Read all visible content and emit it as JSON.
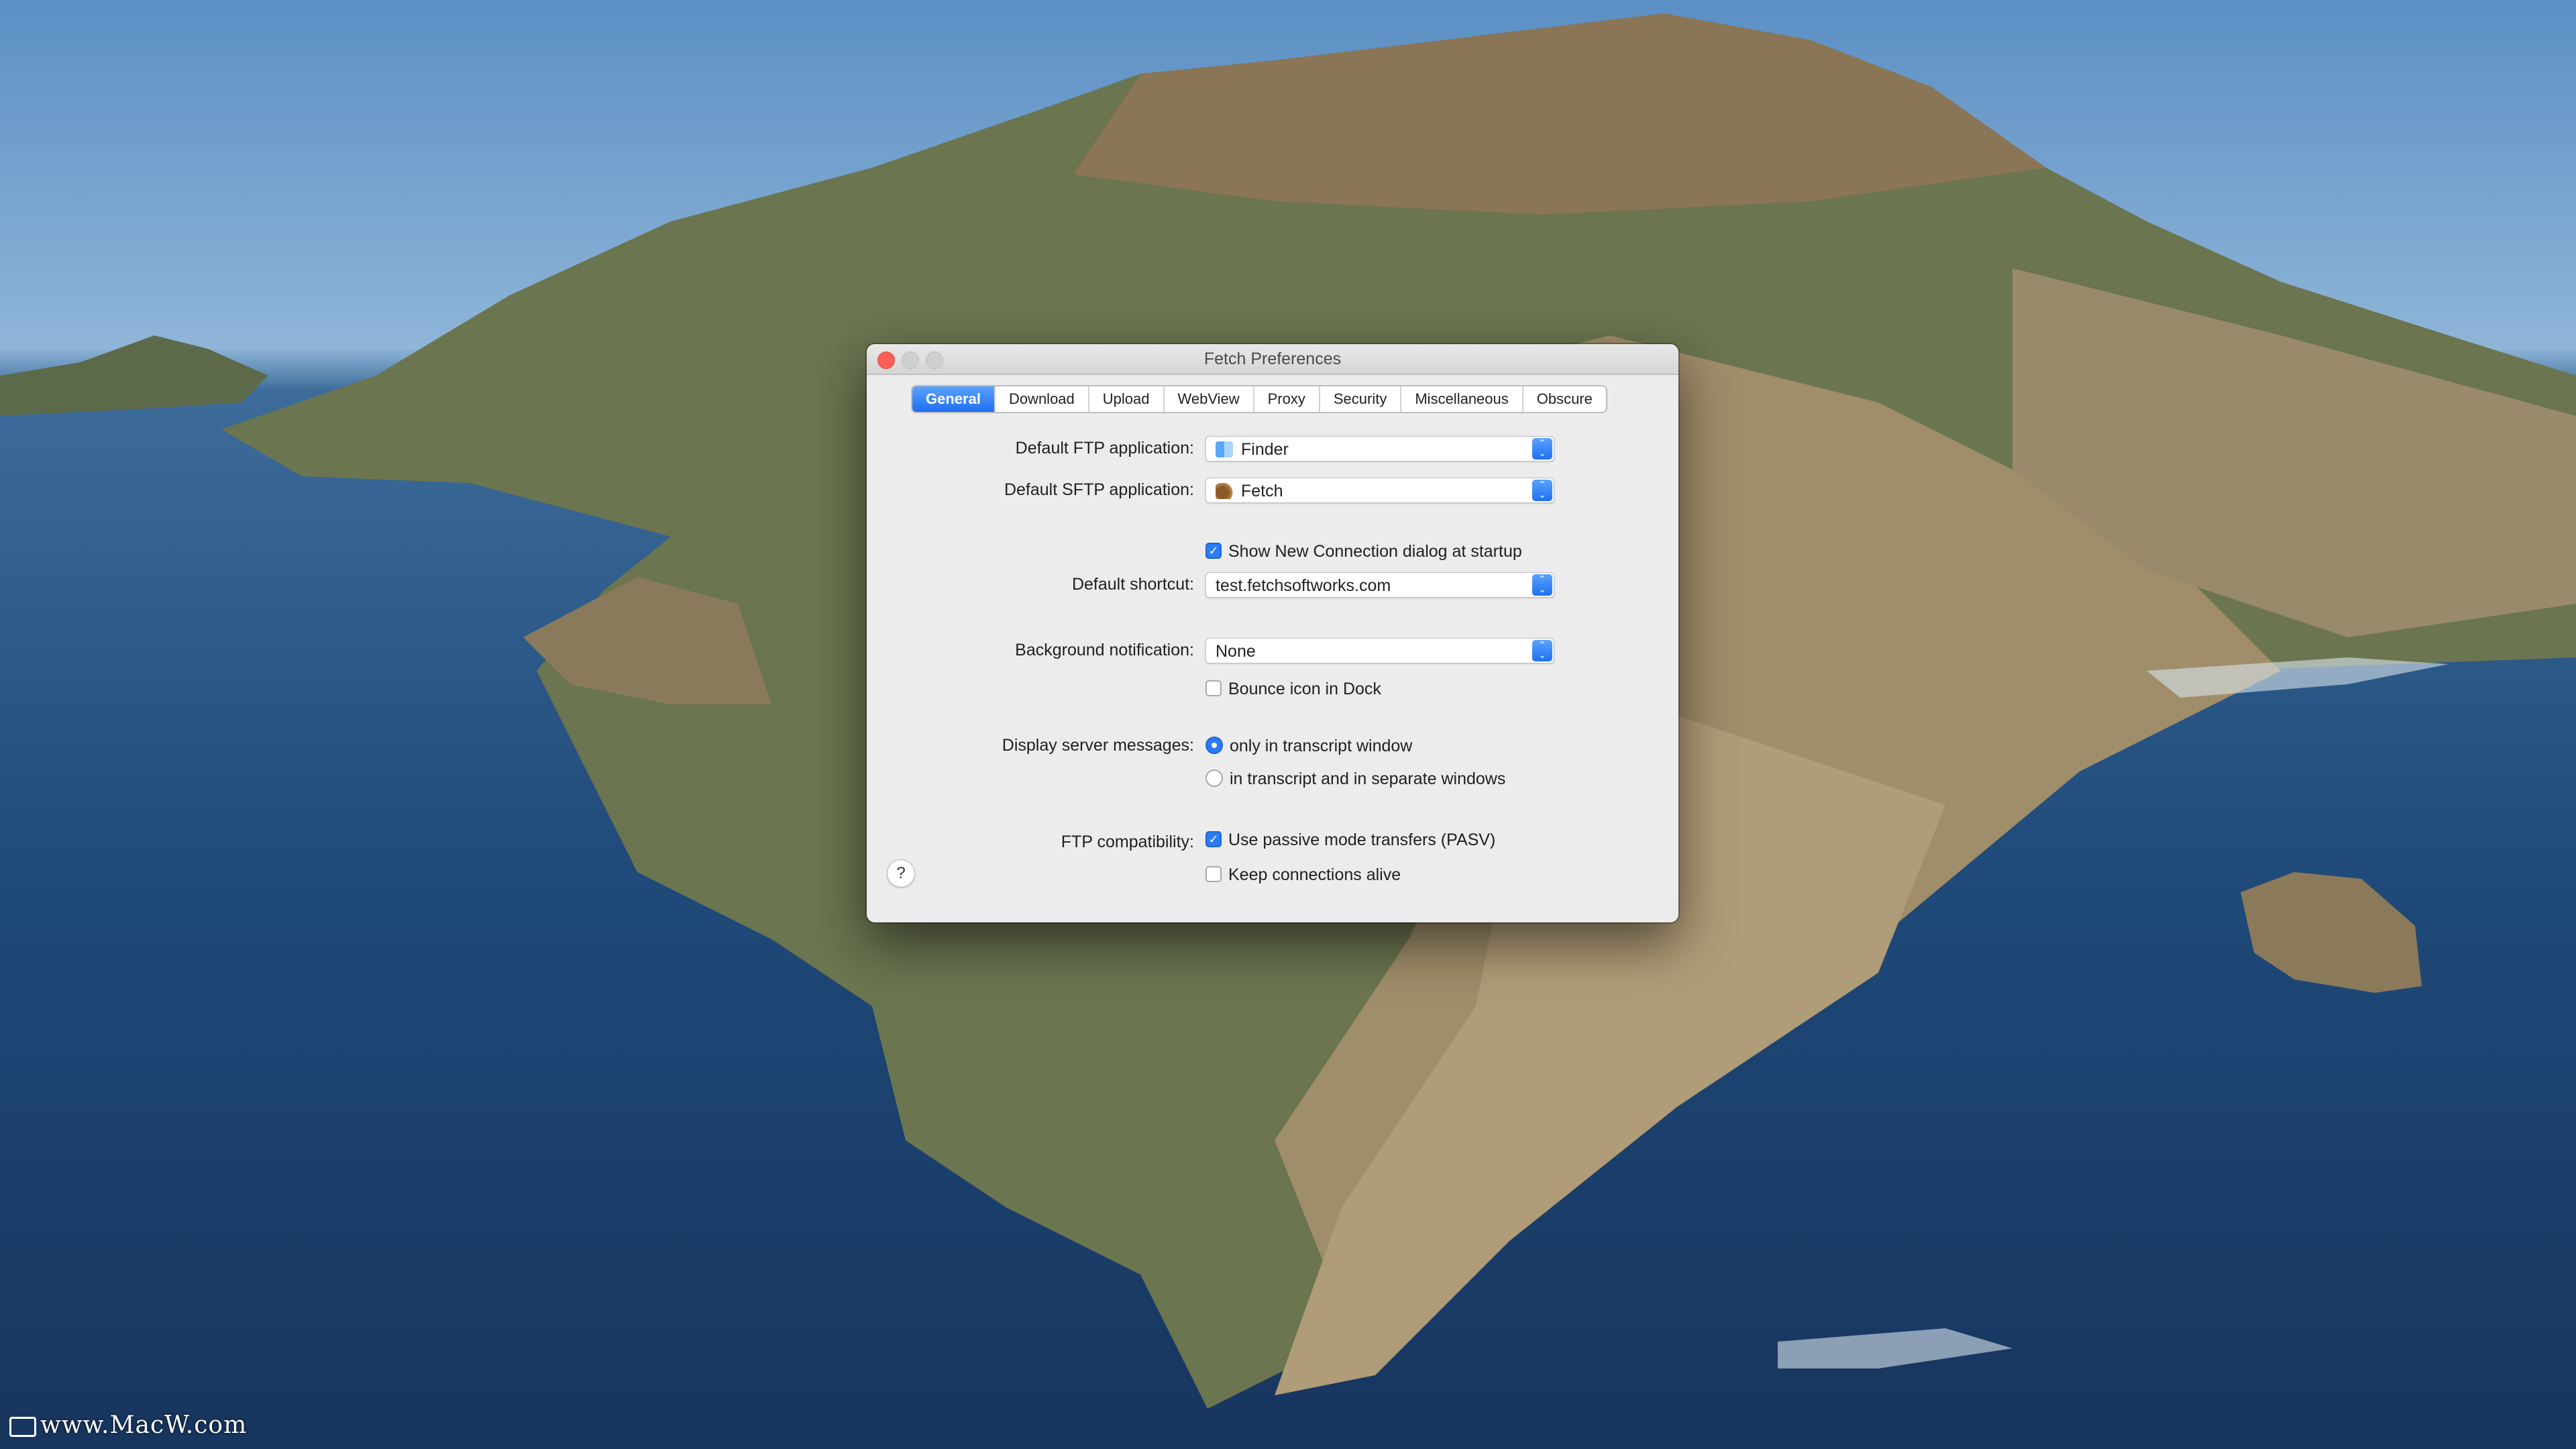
{
  "window": {
    "title": "Fetch Preferences"
  },
  "tabs": [
    {
      "label": "General",
      "active": true
    },
    {
      "label": "Download",
      "active": false
    },
    {
      "label": "Upload",
      "active": false
    },
    {
      "label": "WebView",
      "active": false
    },
    {
      "label": "Proxy",
      "active": false
    },
    {
      "label": "Security",
      "active": false
    },
    {
      "label": "Miscellaneous",
      "active": false
    },
    {
      "label": "Obscure",
      "active": false
    }
  ],
  "general": {
    "ftp_app_label": "Default FTP application:",
    "ftp_app_value": "Finder",
    "ftp_app_icon": "finder-icon",
    "sftp_app_label": "Default SFTP application:",
    "sftp_app_value": "Fetch",
    "sftp_app_icon": "fetch-dog-icon",
    "show_new_connection": {
      "label": "Show New Connection dialog at startup",
      "checked": true
    },
    "shortcut_label": "Default shortcut:",
    "shortcut_value": "test.fetchsoftworks.com",
    "bg_notification_label": "Background notification:",
    "bg_notification_value": "None",
    "bounce_icon": {
      "label": "Bounce icon in Dock",
      "checked": false
    },
    "server_messages_label": "Display server messages:",
    "server_messages_options": [
      {
        "label": "only in transcript window",
        "selected": true
      },
      {
        "label": "in transcript and in separate windows",
        "selected": false
      }
    ],
    "ftp_compat_label": "FTP compatibility:",
    "passive_mode": {
      "label": "Use passive mode transfers (PASV)",
      "checked": true
    },
    "keep_alive": {
      "label": "Keep connections alive",
      "checked": false
    },
    "help_symbol": "?"
  },
  "watermark": "www.MacW.com",
  "colors": {
    "accent": "#2a7cf5",
    "close_button": "#fc5f57",
    "window_bg": "#ececec"
  }
}
